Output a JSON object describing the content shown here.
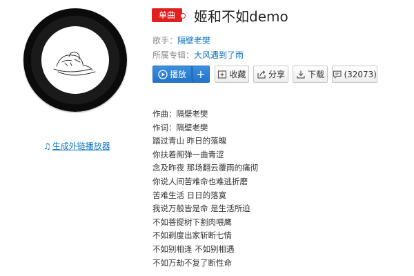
{
  "song": {
    "badge": "单曲",
    "title": "姬和不如demo",
    "singer_label": "歌手：",
    "singer": "隔壁老樊",
    "album_label": "所属专辑：",
    "album": "大风遇到了雨"
  },
  "actions": {
    "play": "播放",
    "add": "+",
    "collect": "收藏",
    "share": "分享",
    "download": "下载",
    "comments": "(32073)"
  },
  "icons": {
    "play": "play-circle-icon",
    "collect": "collect-icon",
    "share": "share-icon",
    "download": "download-icon",
    "comment": "comment-icon",
    "note": "music-note-icon"
  },
  "generate_link": "生成外链播放器",
  "lyrics": [
    "作曲：隔壁老樊",
    "作词：隔壁老樊",
    "踏过青山 昨日的落魄",
    "你扶着阁弹一曲青涩",
    "念及昨夜 那场翻云覆雨的痛彻",
    "你说人间苦难命也难逃折磨",
    "苦难生活 日日的落寞",
    "我说万般皆是命 是生活所迫",
    "不如菩提树下割肉喂鹰",
    "不如剃度出家斩断七情",
    "不如别相逢 不如别相遇",
    "不如万劫不复了断性命"
  ],
  "colors": {
    "accent_blue": "#0c73c2",
    "badge_red": "#e02020",
    "play_blue": "#2174c8"
  }
}
